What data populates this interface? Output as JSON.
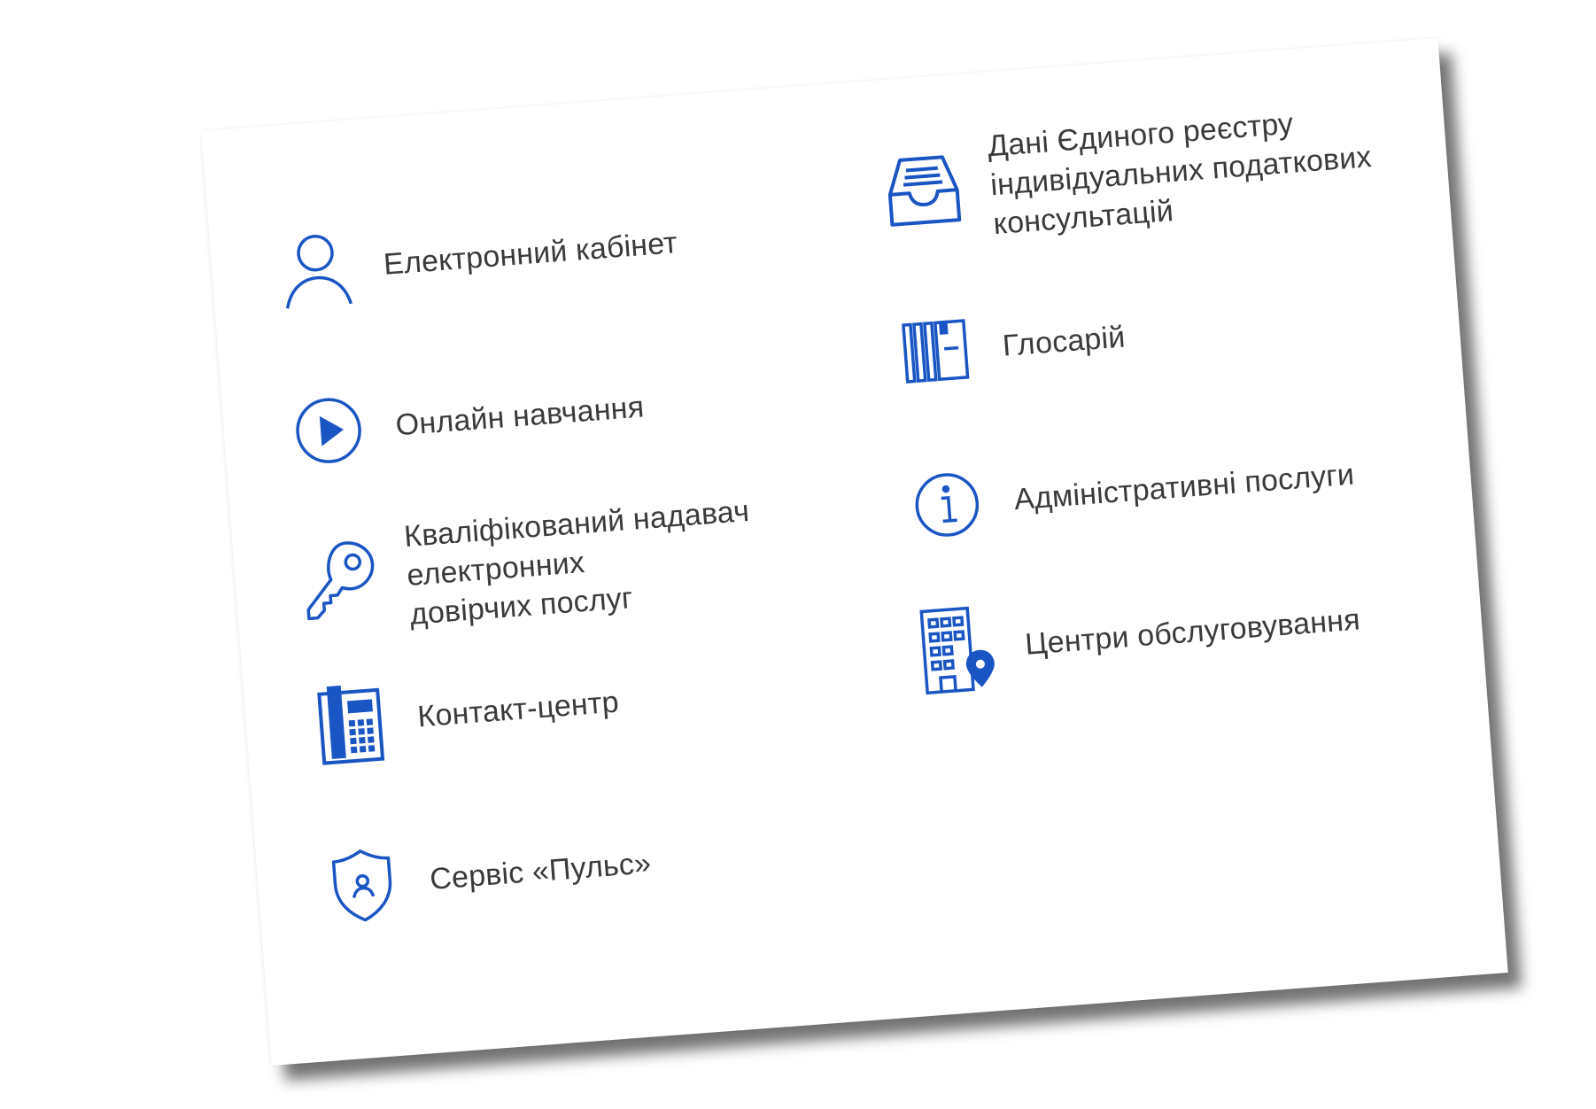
{
  "colors": {
    "accent": "#1a55c4",
    "text": "#3a3a3a",
    "card": "#ffffff"
  },
  "left_items": [
    {
      "label": "Електронний кабінет",
      "icon": "user-icon"
    },
    {
      "label": "Онлайн навчання",
      "icon": "play-circle-icon"
    },
    {
      "label_lines": [
        "Кваліфікований надавач електронних",
        "довірчих послуг"
      ],
      "icon": "key-icon"
    },
    {
      "label": "Контакт-центр",
      "icon": "desk-phone-icon"
    },
    {
      "label": "Сервіс «Пульс»",
      "icon": "shield-user-icon"
    }
  ],
  "right_items": [
    {
      "label_lines": [
        "Дані Єдиного реєстру",
        "індивідуальних податкових",
        "консультацій"
      ],
      "icon": "inbox-tray-icon"
    },
    {
      "label": "Глосарій",
      "icon": "books-icon"
    },
    {
      "label": "Адміністративні послуги",
      "icon": "info-circle-icon"
    },
    {
      "label": "Центри обслуговування",
      "icon": "building-location-icon"
    }
  ]
}
